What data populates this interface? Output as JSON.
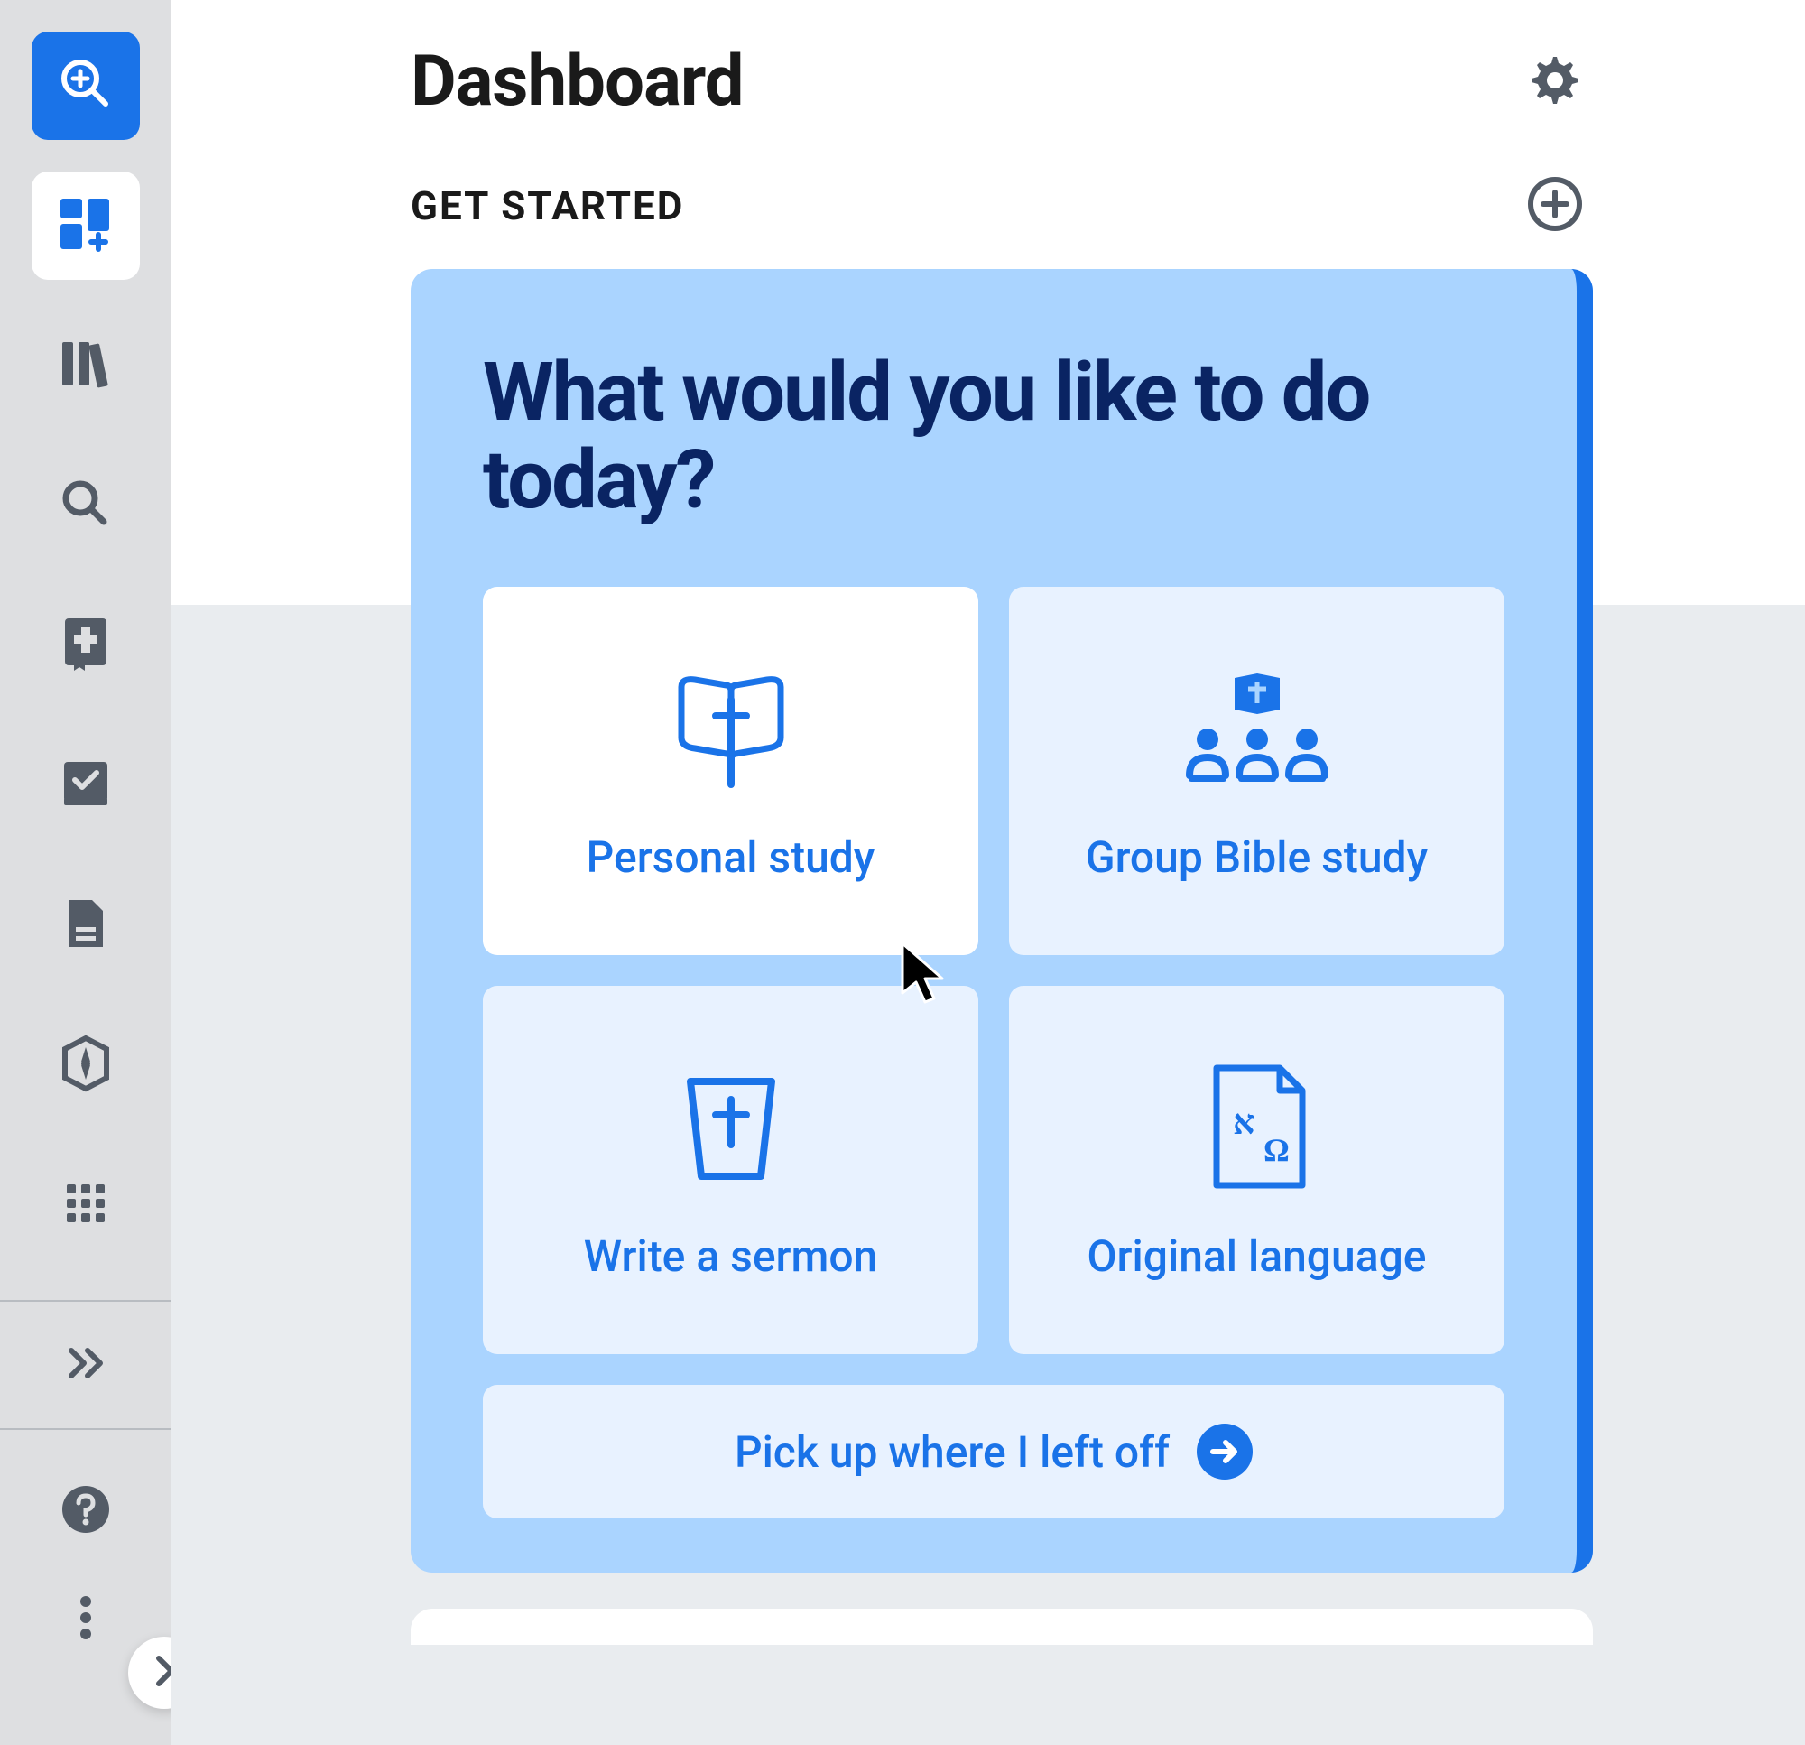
{
  "header": {
    "title": "Dashboard"
  },
  "section": {
    "title": "GET STARTED"
  },
  "card": {
    "title": "What would you like to do today?",
    "tiles": [
      {
        "label": "Personal study",
        "icon": "bible-cross-icon"
      },
      {
        "label": "Group Bible study",
        "icon": "group-study-icon"
      },
      {
        "label": "Write a sermon",
        "icon": "pulpit-icon"
      },
      {
        "label": "Original language",
        "icon": "original-language-icon"
      }
    ],
    "resume_label": "Pick up where I left off"
  },
  "sidebar": {
    "items": [
      {
        "name": "search-magnify-plus",
        "active": "blue"
      },
      {
        "name": "dashboard-tiles-add",
        "active": "white"
      },
      {
        "name": "library-books",
        "active": "none"
      },
      {
        "name": "search",
        "active": "none"
      },
      {
        "name": "bible-book",
        "active": "none"
      },
      {
        "name": "checkbox-task",
        "active": "none"
      },
      {
        "name": "document",
        "active": "none"
      },
      {
        "name": "compass-nav",
        "active": "none"
      },
      {
        "name": "apps-grid",
        "active": "none"
      }
    ]
  },
  "colors": {
    "primary_blue": "#1a73e8",
    "dark_navy": "#0a2463",
    "light_blue_card": "#aad4ff",
    "tile_bg": "#e8f2ff",
    "sidebar_bg": "#dedfe1",
    "icon_gray": "#535b66"
  }
}
